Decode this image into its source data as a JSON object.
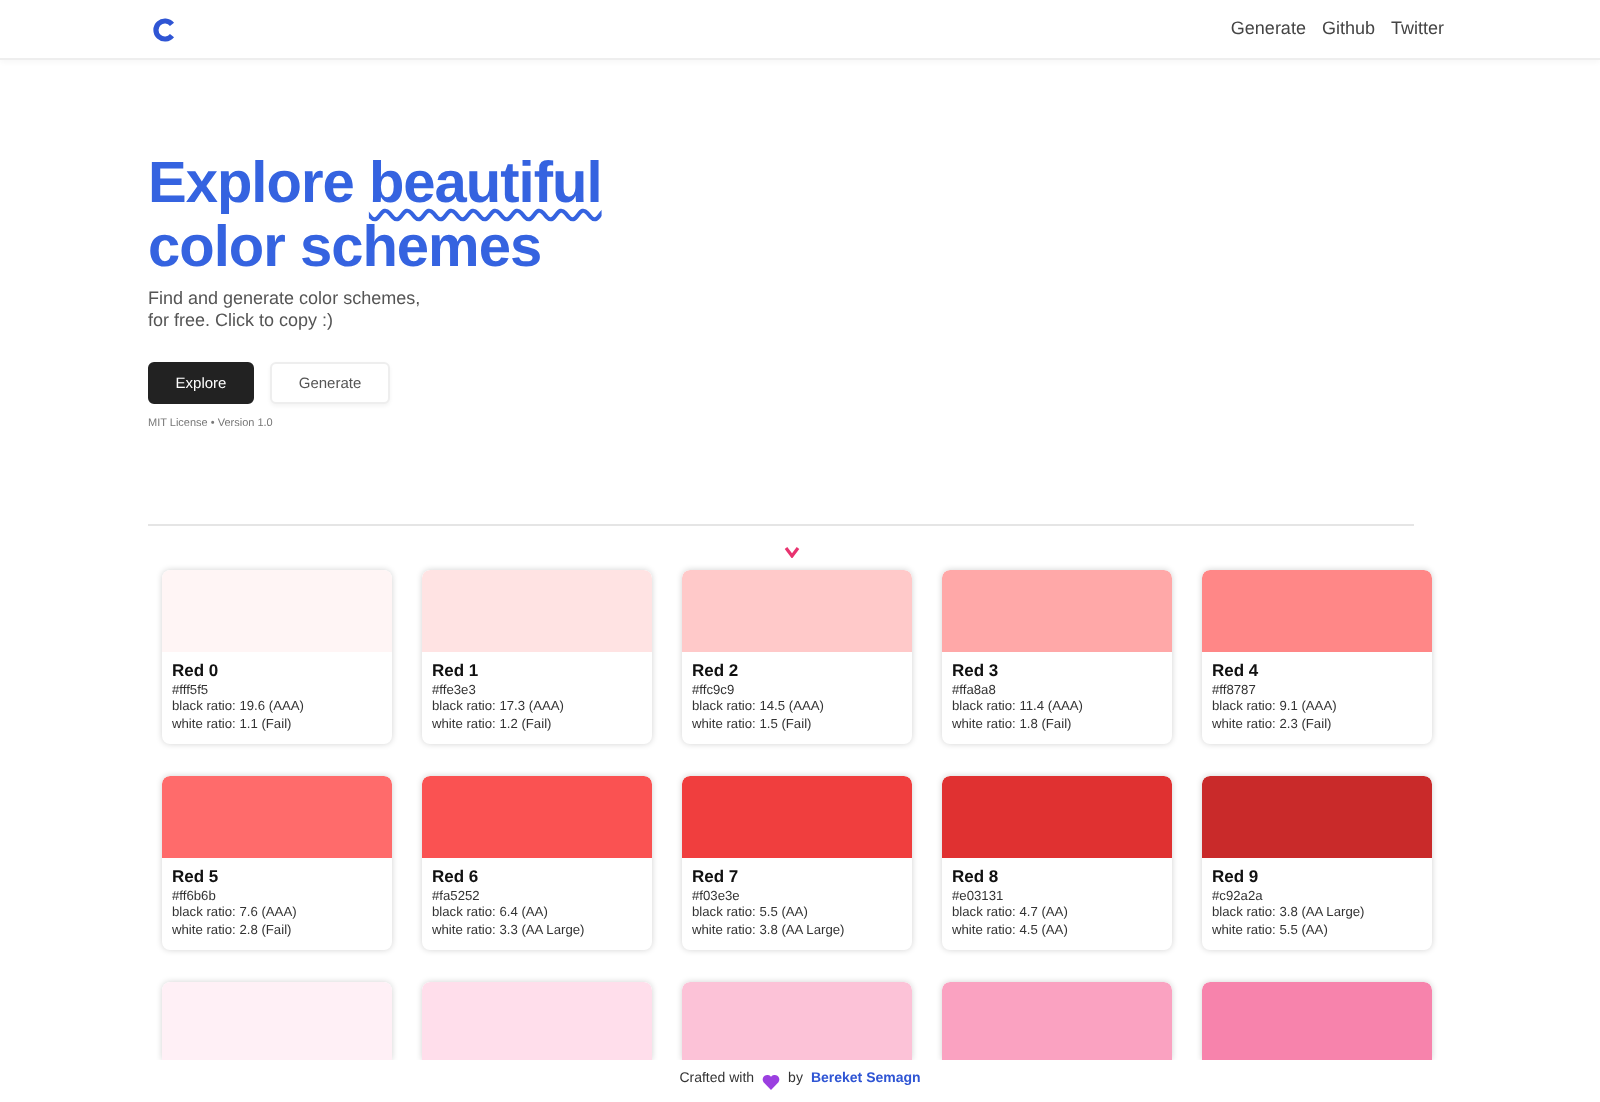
{
  "nav": {
    "links": [
      "Generate",
      "Github",
      "Twitter"
    ]
  },
  "hero": {
    "title_start": "Explore",
    "title_highlight": "beautiful",
    "title_end": "color schemes",
    "subtitle_line_1": "Find and generate color schemes,",
    "subtitle_line_2": "for free. Click to copy :)",
    "buttons": [
      {
        "label": "Explore",
        "kind": "primary"
      },
      {
        "label": "Generate",
        "kind": "outline"
      }
    ],
    "meta": "MIT License • Version 1.0"
  },
  "colors": [
    {
      "name": "Red 0",
      "hex": "#fff5f5",
      "black_ratio": "black ratio: 19.6 (AAA)",
      "white_ratio": "white ratio: 1.1 (Fail)",
      "color": "#fff5f5"
    },
    {
      "name": "Red 1",
      "hex": "#ffe3e3",
      "black_ratio": "black ratio: 17.3 (AAA)",
      "white_ratio": "white ratio: 1.2 (Fail)",
      "color": "#ffe3e3"
    },
    {
      "name": "Red 2",
      "hex": "#ffc9c9",
      "black_ratio": "black ratio: 14.5 (AAA)",
      "white_ratio": "white ratio: 1.5 (Fail)",
      "color": "#ffc9c9"
    },
    {
      "name": "Red 3",
      "hex": "#ffa8a8",
      "black_ratio": "black ratio: 11.4 (AAA)",
      "white_ratio": "white ratio: 1.8 (Fail)",
      "color": "#ffa8a8"
    },
    {
      "name": "Red 4",
      "hex": "#ff8787",
      "black_ratio": "black ratio: 9.1 (AAA)",
      "white_ratio": "white ratio: 2.3 (Fail)",
      "color": "#ff8787"
    },
    {
      "name": "Red 5",
      "hex": "#ff6b6b",
      "black_ratio": "black ratio: 7.6 (AAA)",
      "white_ratio": "white ratio: 2.8 (Fail)",
      "color": "#ff6b6b"
    },
    {
      "name": "Red 6",
      "hex": "#fa5252",
      "black_ratio": "black ratio: 6.4 (AA)",
      "white_ratio": "white ratio: 3.3 (AA Large)",
      "color": "#fa5252"
    },
    {
      "name": "Red 7",
      "hex": "#f03e3e",
      "black_ratio": "black ratio: 5.5 (AA)",
      "white_ratio": "white ratio: 3.8 (AA Large)",
      "color": "#f03e3e"
    },
    {
      "name": "Red 8",
      "hex": "#e03131",
      "black_ratio": "black ratio: 4.7 (AA)",
      "white_ratio": "white ratio: 4.5 (AA)",
      "color": "#e03131"
    },
    {
      "name": "Red 9",
      "hex": "#c92a2a",
      "black_ratio": "black ratio: 3.8 (AA Large)",
      "white_ratio": "white ratio: 5.5 (AA)",
      "color": "#c92a2a"
    },
    {
      "color": "#fff0f6"
    },
    {
      "color": "#ffdeeb"
    },
    {
      "color": "#fcc2d7"
    },
    {
      "color": "#faa2c1"
    },
    {
      "color": "#f783ac"
    }
  ],
  "footer": {
    "text_before": "Crafted with",
    "text_by": "by",
    "author": "Bereket Semagn"
  }
}
